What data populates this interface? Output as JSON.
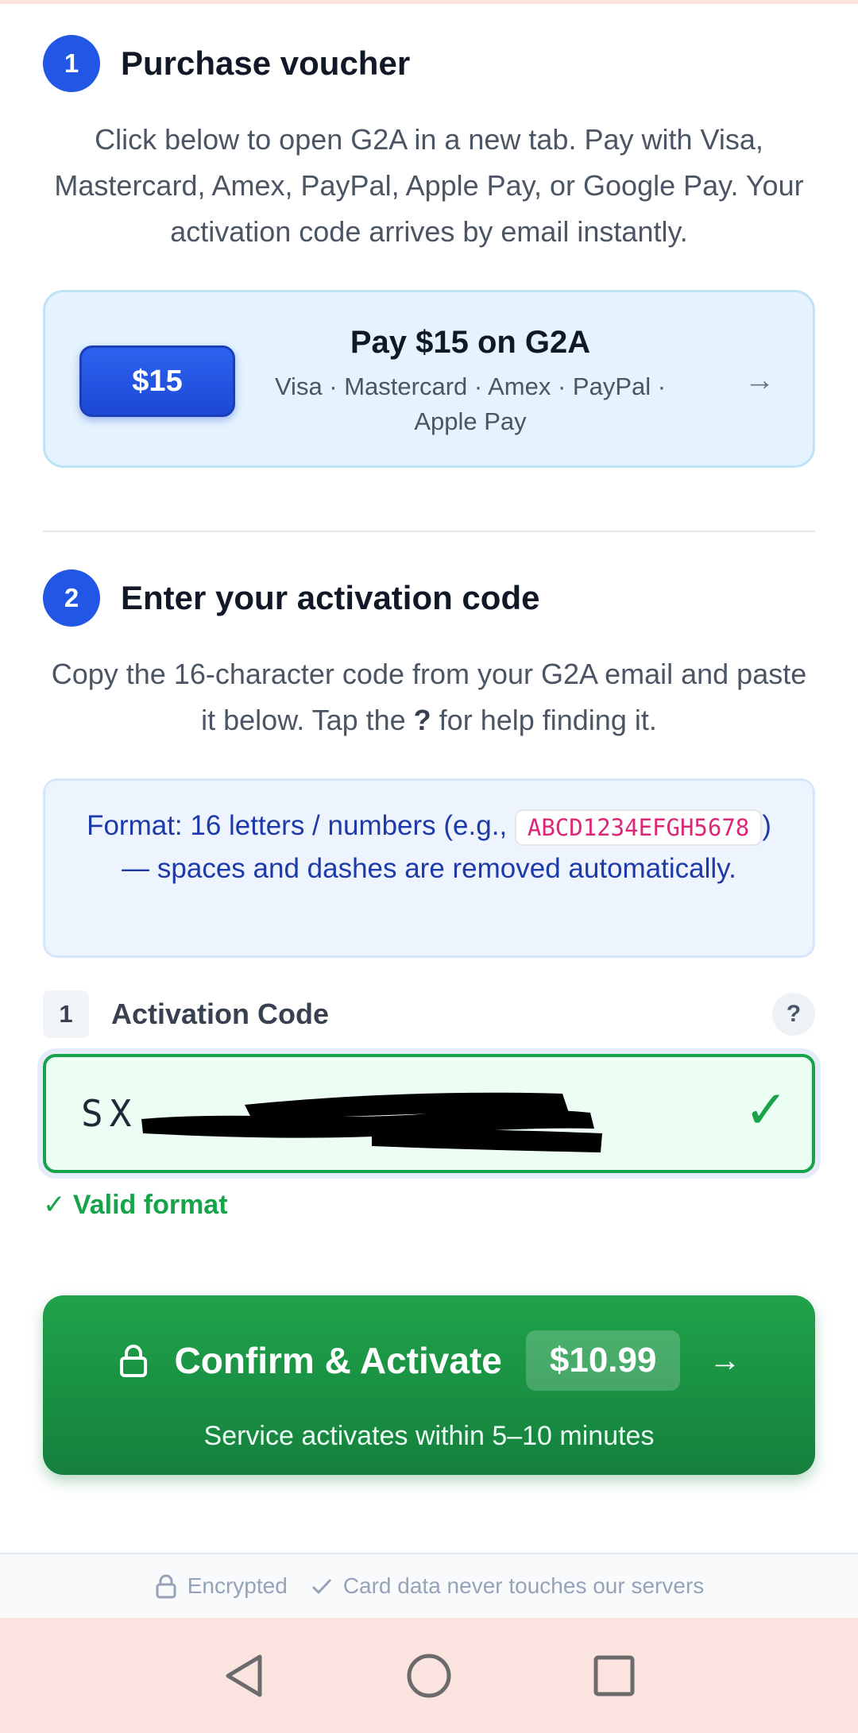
{
  "step1": {
    "number": "1",
    "title": "Purchase voucher",
    "description": "Click below to open G2A in a new tab. Pay with Visa, Mastercard, Amex, PayPal, Apple Pay, or Google Pay. Your activation code arrives by email instantly.",
    "pay_card": {
      "price": "$15",
      "title": "Pay $15 on G2A",
      "methods": "Visa · Mastercard · Amex · PayPal · Apple Pay",
      "arrow": "→"
    }
  },
  "step2": {
    "number": "2",
    "title": "Enter your activation code",
    "description_before": "Copy the 16-character code from your G2A email and paste it below. Tap the ",
    "description_bold": "?",
    "description_after": " for help finding it.",
    "format_before": "Format: 16 letters / numbers (e.g., ",
    "format_example": "ABCD1234EFGH5678",
    "format_after": ") — spaces and dashes are removed automatically."
  },
  "field": {
    "number": "1",
    "label": "Activation Code",
    "help": "?",
    "value": "SX",
    "valid_icon": "✓",
    "valid_message": "✓ Valid format"
  },
  "confirm": {
    "label": "Confirm & Activate",
    "price": "$10.99",
    "arrow": "→",
    "subtext": "Service activates within 5–10 minutes"
  },
  "footer": {
    "encrypted": "Encrypted",
    "card_note": "Card data never touches our servers"
  },
  "colors": {
    "primary": "#2256e4",
    "success": "#16a34a",
    "nav_bg": "#fbe4e0"
  },
  "icons": [
    "lock-icon",
    "check-icon",
    "back-icon",
    "home-icon",
    "recents-icon"
  ]
}
